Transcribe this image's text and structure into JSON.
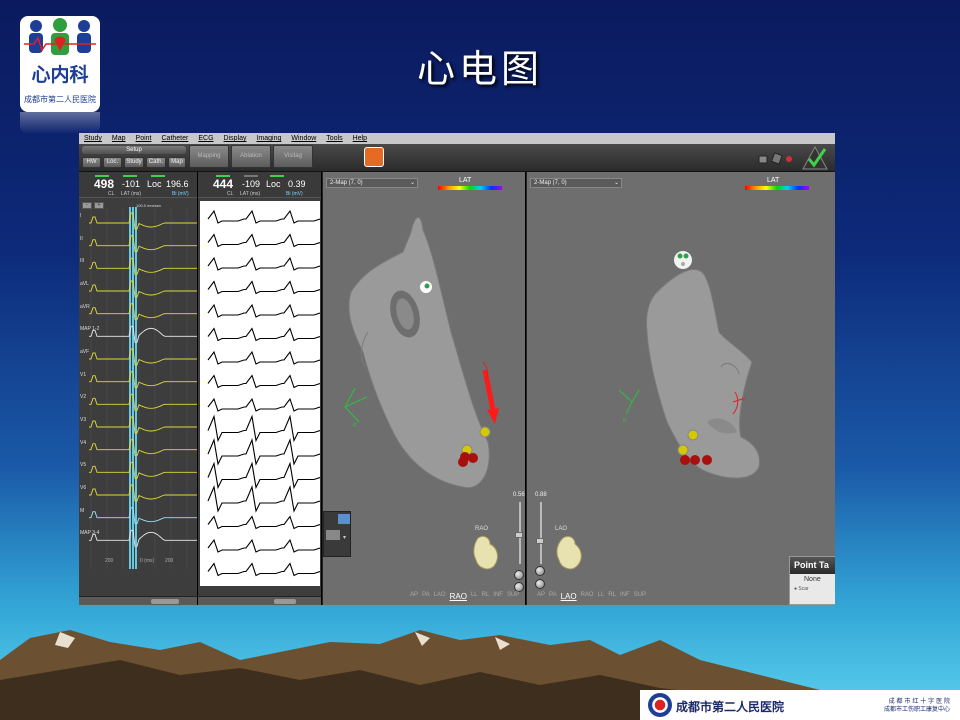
{
  "slide": {
    "title": "心电图",
    "logo_name": "心内科",
    "logo_sub": "成都市第二人民医院",
    "footer_name": "成都市第二人民医院",
    "footer_right_1": "成 都 市 红 十 字 医 院",
    "footer_right_2": "成都市工伤职工康复中心"
  },
  "app": {
    "menu": [
      "Study",
      "Map",
      "Point",
      "Catheter",
      "ECG",
      "Display",
      "Imaging",
      "Window",
      "Tools",
      "Help"
    ],
    "toolbar": {
      "setup": "Setup",
      "buttons": [
        "HW",
        "Loc.",
        "Study",
        "Cath.",
        "Map"
      ],
      "big_buttons": [
        "Mapping",
        "Ablation",
        "Visitag"
      ]
    },
    "ecg_left": {
      "cl_value": "498",
      "cl_unit": "CL",
      "lat_value": "-101",
      "lat_unit": "LAT (ms)",
      "loc_label": "Loc",
      "loc_value": "196.6",
      "loc_unit": "Bi (mV)",
      "speed": "100.0 mm/sec",
      "leads": [
        "I",
        "II",
        "III",
        "aVL",
        "aVR",
        "MAP 1-2",
        "aVF",
        "V1",
        "V2",
        "V3",
        "V4",
        "V5",
        "V6",
        "M",
        "MAP 3-4"
      ],
      "scale_left": "200",
      "scale_mid": "0 (ms)",
      "scale_right": "200"
    },
    "ecg_right": {
      "cl_value": "444",
      "cl_unit": "CL",
      "lat_value": "-109",
      "lat_unit": "LAT (ms)",
      "loc_label": "Loc",
      "loc_value": "0.39",
      "loc_unit": "Bi (mV)"
    },
    "map_left": {
      "dropdown": "2-Map (7, 0)",
      "lat_label": "LAT",
      "opacity": "0.56",
      "orient": "RAO",
      "views": [
        "AP",
        "PA",
        "LAO",
        "RAO",
        "LL",
        "RL",
        "INF",
        "SUP"
      ],
      "selected_view": "RAO"
    },
    "map_right": {
      "dropdown": "2-Map (7, 0)",
      "lat_label": "LAT",
      "opacity": "0.88",
      "orient": "LAO",
      "views": [
        "AP",
        "PA",
        "LAO",
        "RAO",
        "LL",
        "RL",
        "INF",
        "SUP"
      ],
      "selected_view": "LAO",
      "point_table_title": "Point Ta",
      "point_table_row": "None",
      "point_table_row2": "Scar"
    }
  }
}
